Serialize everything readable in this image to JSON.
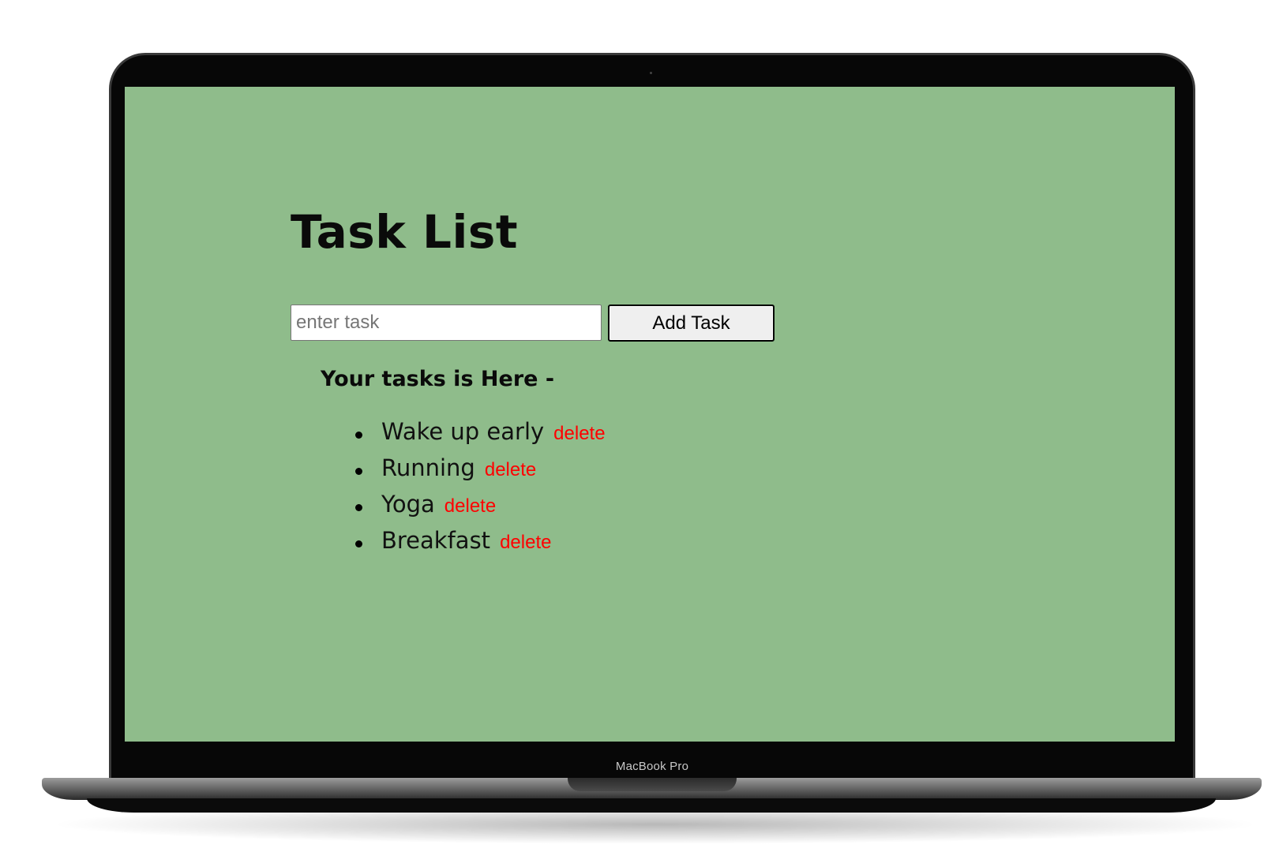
{
  "device": {
    "label": "MacBook Pro"
  },
  "app": {
    "title": "Task List",
    "input": {
      "value": "",
      "placeholder": "enter task"
    },
    "add_button_label": "Add Task",
    "subtitle": "Your tasks is Here -",
    "tasks": [
      {
        "label": "Wake up early",
        "delete_label": "delete"
      },
      {
        "label": "Running",
        "delete_label": "delete"
      },
      {
        "label": "Yoga",
        "delete_label": "delete"
      },
      {
        "label": "Breakfast",
        "delete_label": "delete"
      }
    ]
  },
  "colors": {
    "background": "#8fbc8b",
    "delete": "#ff0000",
    "text": "#0a0a0a"
  }
}
